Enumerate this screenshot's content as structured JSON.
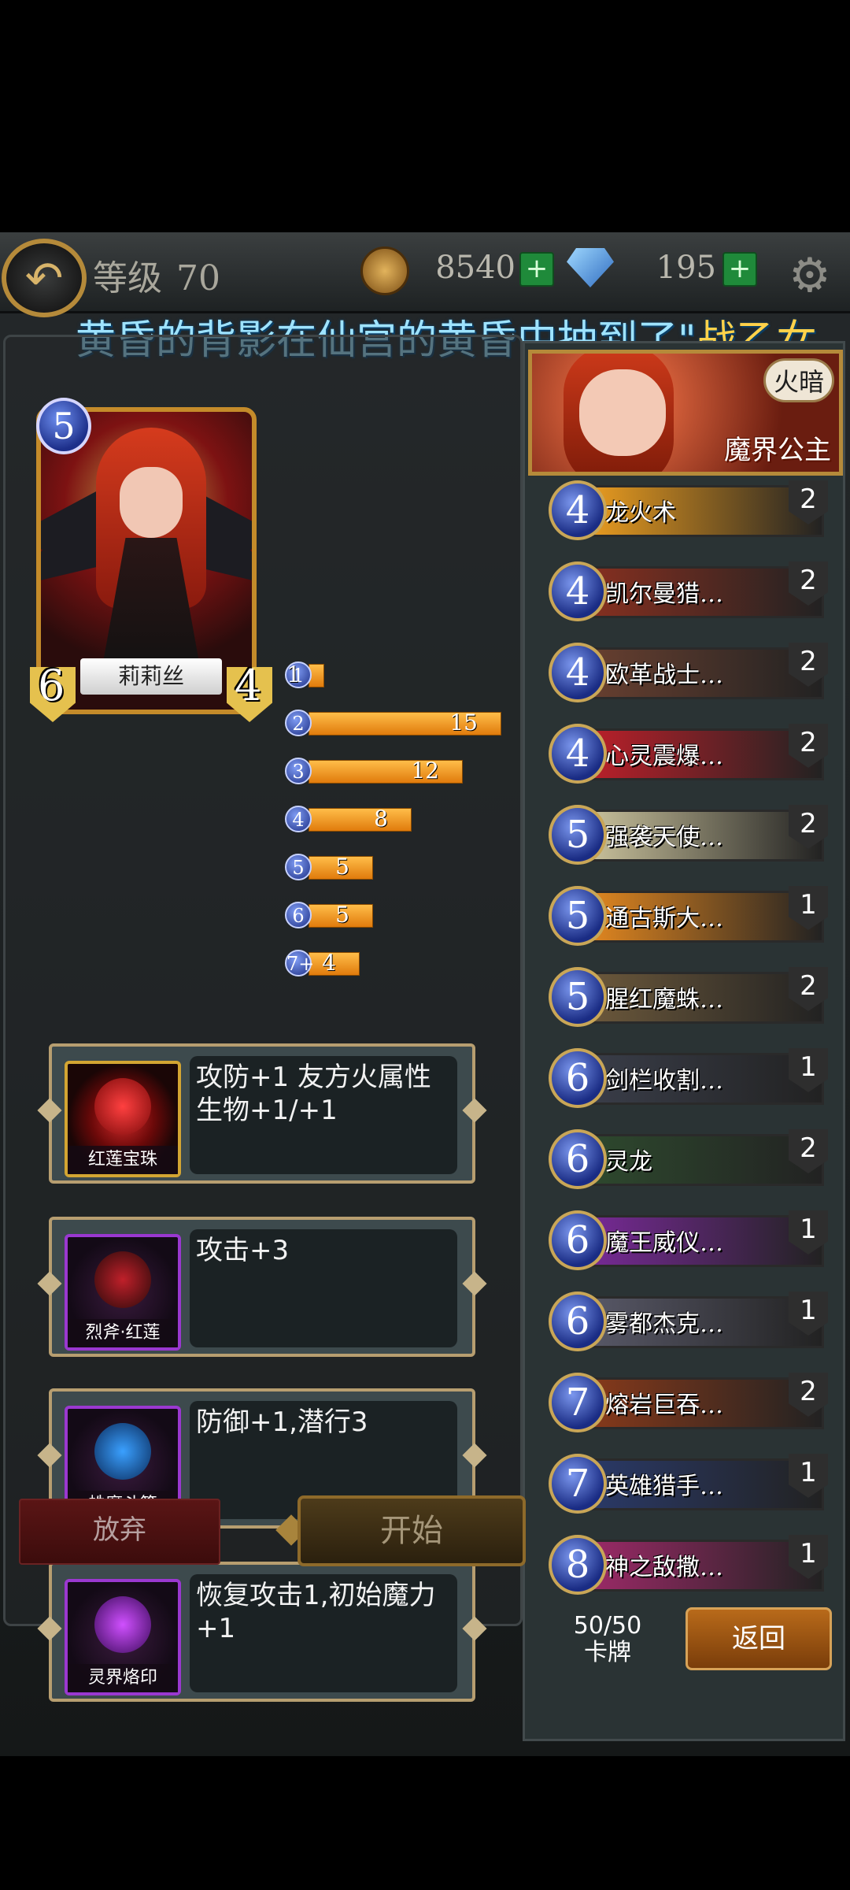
{
  "topbar": {
    "level_label": "等级",
    "level": "70",
    "coins": "8540",
    "gems": "195"
  },
  "banner": {
    "text": "黄昏的背影在仙宫的黄昏中抽到了\"",
    "highlight": "战乙女"
  },
  "hero": {
    "name": "莉莉丝",
    "cost": "5",
    "attack": "6",
    "health": "4"
  },
  "curve": [
    {
      "cost": "1",
      "count": 1
    },
    {
      "cost": "2",
      "count": 15
    },
    {
      "cost": "3",
      "count": 12
    },
    {
      "cost": "4",
      "count": 8
    },
    {
      "cost": "5",
      "count": 5
    },
    {
      "cost": "6",
      "count": 5
    },
    {
      "cost": "7+",
      "count": 4
    }
  ],
  "skills": [
    {
      "name": "红莲宝珠",
      "desc": "攻防+1\n友方火属性生物+1/+1",
      "frame": "gold"
    },
    {
      "name": "烈斧·红莲",
      "desc": "攻击+3",
      "frame": "purple"
    },
    {
      "name": "蛛魔斗篷",
      "desc": "防御+1,潜行3",
      "frame": "purple"
    },
    {
      "name": "灵界烙印",
      "desc": "恢复攻击1,初始魔力+1",
      "frame": "purple"
    }
  ],
  "leader": {
    "title": "魔界公主",
    "badge": "火暗"
  },
  "deck": [
    {
      "cost": "4",
      "name": "龙火术",
      "count": "2",
      "color": "#f0a020"
    },
    {
      "cost": "4",
      "name": "凯尔曼猎…",
      "count": "2",
      "color": "#8a3020"
    },
    {
      "cost": "4",
      "name": "欧革战士…",
      "count": "2",
      "color": "#6a4030"
    },
    {
      "cost": "4",
      "name": "心灵震爆…",
      "count": "2",
      "color": "#c0202a"
    },
    {
      "cost": "5",
      "name": "强袭天使…",
      "count": "2",
      "color": "#cfc7a0"
    },
    {
      "cost": "5",
      "name": "通古斯大…",
      "count": "1",
      "color": "#e88a20"
    },
    {
      "cost": "5",
      "name": "腥红魔蛛…",
      "count": "2",
      "color": "#6e5a3c"
    },
    {
      "cost": "6",
      "name": "剑栏收割…",
      "count": "1",
      "color": "#3a3e4a"
    },
    {
      "cost": "6",
      "name": "灵龙",
      "count": "2",
      "color": "#2e4a2e"
    },
    {
      "cost": "6",
      "name": "魔王威仪…",
      "count": "1",
      "color": "#7a2a9a"
    },
    {
      "cost": "6",
      "name": "雾都杰克…",
      "count": "1",
      "color": "#5a5a6a"
    },
    {
      "cost": "7",
      "name": "熔岩巨吞…",
      "count": "2",
      "color": "#8a3a1a"
    },
    {
      "cost": "7",
      "name": "英雄猎手…",
      "count": "1",
      "color": "#2a3a6a"
    },
    {
      "cost": "8",
      "name": "神之敌撒…",
      "count": "1",
      "color": "#a02a6a"
    }
  ],
  "deck_count": "50/50",
  "deck_label": "卡牌",
  "buttons": {
    "give_up": "放弃",
    "start": "开始",
    "return": "返回"
  },
  "colors": {
    "accent": "#b58a3a",
    "bar": "#f0a020",
    "banner": "#9ee3ff"
  }
}
